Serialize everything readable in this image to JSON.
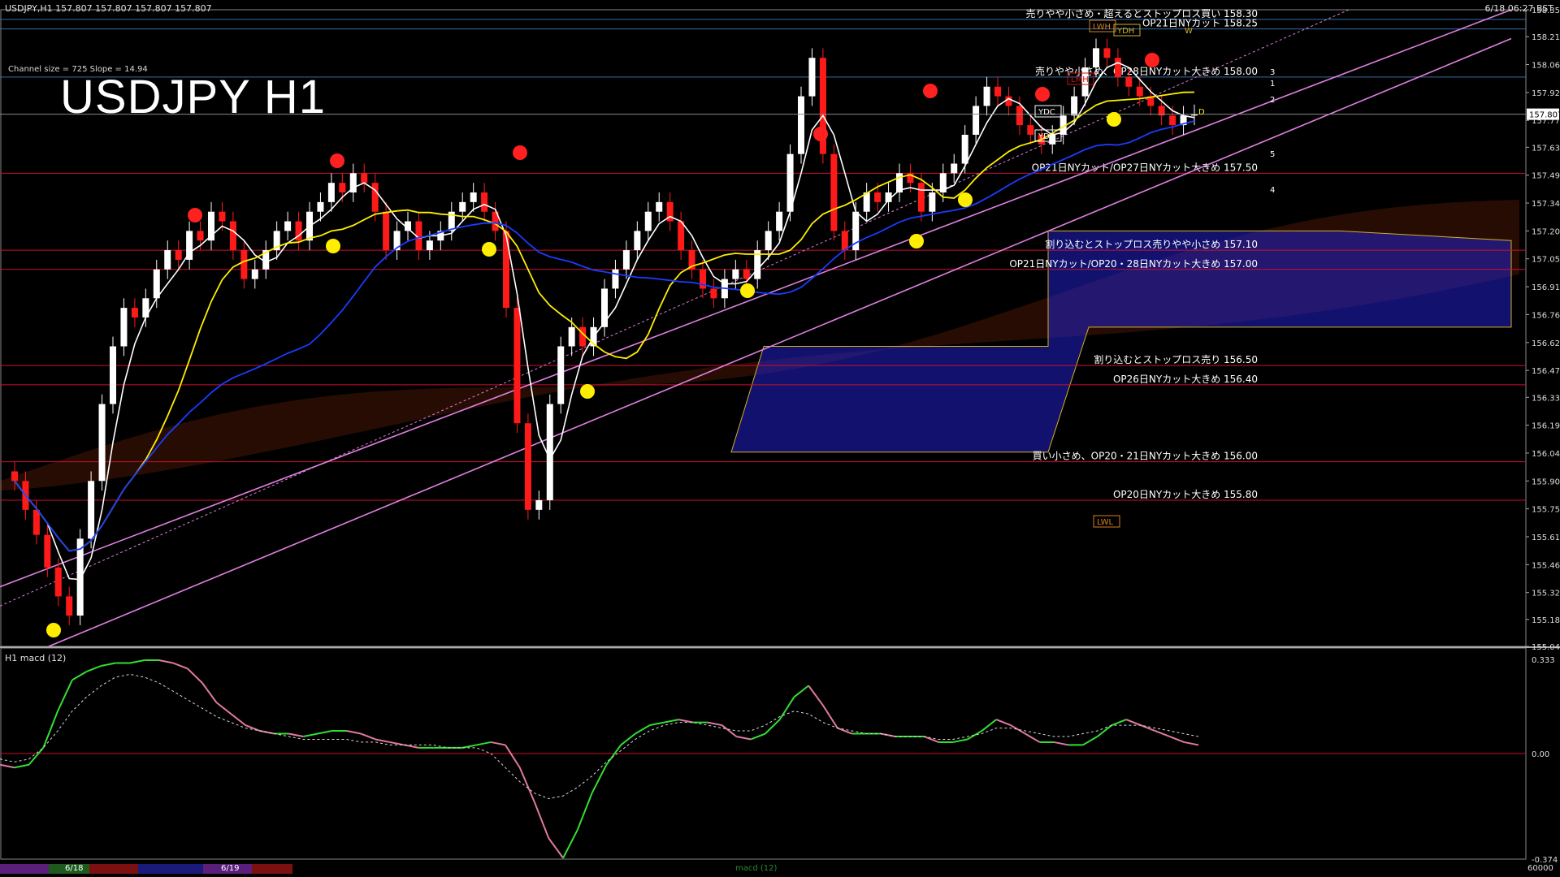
{
  "header": {
    "symbol_line": "USDJPY,H1  157.807 157.807 157.807 157.807",
    "timestamp": "6/18 06:27 BST",
    "channel_info": "Channel size = 725 Slope = 14.94",
    "title": "USDJPY H1"
  },
  "colors": {
    "background": "#000000",
    "grid_h": "#3a6ea5",
    "level_red": "#c8102e",
    "channel": "#e080e0",
    "candle_bull": "#ffffff",
    "candle_bear": "#ff1a1a",
    "ma_fast": "#ffffff",
    "ma_mid": "#ffee00",
    "ma_slow": "#1a3cff",
    "ichimoku_bull": "#2020c8",
    "ichimoku_bear": "#d04010",
    "macd": "#32e032",
    "macd_neg": "#e07aa0",
    "signal": "#d8d8d8"
  },
  "chart_data": {
    "type": "candlestick",
    "title": "USDJPY H1",
    "ylim": [
      155.04,
      158.35
    ],
    "y_ticks": [
      158.35,
      158.21,
      158.065,
      157.92,
      157.775,
      157.635,
      157.49,
      157.345,
      157.2,
      157.055,
      156.91,
      156.765,
      156.62,
      156.475,
      156.335,
      156.19,
      156.045,
      155.9,
      155.755,
      155.61,
      155.465,
      155.32,
      155.18,
      155.04
    ],
    "current_price": "157.807",
    "closes": [
      155.9,
      155.75,
      155.62,
      155.45,
      155.3,
      155.2,
      155.6,
      155.9,
      156.3,
      156.6,
      156.8,
      156.75,
      156.85,
      157.0,
      157.1,
      157.05,
      157.2,
      157.15,
      157.3,
      157.25,
      157.1,
      156.95,
      157.0,
      157.1,
      157.2,
      157.25,
      157.15,
      157.3,
      157.35,
      157.45,
      157.4,
      157.5,
      157.45,
      157.3,
      157.1,
      157.2,
      157.25,
      157.1,
      157.15,
      157.2,
      157.3,
      157.35,
      157.4,
      157.3,
      157.2,
      156.8,
      156.2,
      155.75,
      155.8,
      156.3,
      156.6,
      156.7,
      156.6,
      156.7,
      156.9,
      157.0,
      157.1,
      157.2,
      157.3,
      157.35,
      157.25,
      157.1,
      157.0,
      156.9,
      156.85,
      156.95,
      157.0,
      156.95,
      157.1,
      157.2,
      157.3,
      157.6,
      157.9,
      158.1,
      157.6,
      157.2,
      157.1,
      157.3,
      157.4,
      157.35,
      157.4,
      157.5,
      157.45,
      157.3,
      157.4,
      157.5,
      157.55,
      157.7,
      157.85,
      157.95,
      157.9,
      157.85,
      157.75,
      157.7,
      157.65,
      157.7,
      157.8,
      157.9,
      158.05,
      158.15,
      158.1,
      158.0,
      157.95,
      157.9,
      157.85,
      157.8,
      157.75,
      157.8,
      157.807
    ],
    "macd": [
      -0.04,
      -0.05,
      -0.04,
      0.02,
      0.15,
      0.26,
      0.29,
      0.31,
      0.32,
      0.32,
      0.33,
      0.33,
      0.32,
      0.3,
      0.25,
      0.18,
      0.14,
      0.1,
      0.08,
      0.07,
      0.07,
      0.06,
      0.07,
      0.08,
      0.08,
      0.07,
      0.05,
      0.04,
      0.03,
      0.02,
      0.02,
      0.02,
      0.02,
      0.03,
      0.04,
      0.03,
      -0.05,
      -0.17,
      -0.3,
      -0.37,
      -0.27,
      -0.14,
      -0.04,
      0.03,
      0.07,
      0.1,
      0.11,
      0.12,
      0.11,
      0.11,
      0.1,
      0.06,
      0.05,
      0.07,
      0.12,
      0.2,
      0.24,
      0.17,
      0.09,
      0.07,
      0.07,
      0.07,
      0.06,
      0.06,
      0.06,
      0.04,
      0.04,
      0.05,
      0.08,
      0.12,
      0.1,
      0.07,
      0.04,
      0.04,
      0.03,
      0.03,
      0.06,
      0.1,
      0.12,
      0.1,
      0.08,
      0.06,
      0.04,
      0.03
    ],
    "macd_signal": [
      -0.02,
      -0.03,
      -0.02,
      0.02,
      0.08,
      0.15,
      0.2,
      0.24,
      0.27,
      0.28,
      0.27,
      0.25,
      0.22,
      0.19,
      0.16,
      0.13,
      0.11,
      0.09,
      0.08,
      0.07,
      0.06,
      0.05,
      0.05,
      0.05,
      0.05,
      0.04,
      0.04,
      0.03,
      0.03,
      0.03,
      0.03,
      0.02,
      0.02,
      0.02,
      0.0,
      -0.05,
      -0.1,
      -0.14,
      -0.16,
      -0.15,
      -0.12,
      -0.08,
      -0.03,
      0.01,
      0.05,
      0.08,
      0.1,
      0.11,
      0.11,
      0.1,
      0.09,
      0.08,
      0.08,
      0.1,
      0.13,
      0.15,
      0.14,
      0.11,
      0.09,
      0.08,
      0.07,
      0.07,
      0.06,
      0.06,
      0.06,
      0.05,
      0.05,
      0.06,
      0.07,
      0.09,
      0.09,
      0.08,
      0.07,
      0.06,
      0.06,
      0.07,
      0.08,
      0.1,
      0.1,
      0.1,
      0.09,
      0.08,
      0.07,
      0.06
    ],
    "macd_ylim": [
      -0.374,
      0.333
    ],
    "macd_ticks": [
      "0.333",
      "0.00",
      "-0.374"
    ],
    "macd_title": "H1  macd (12)",
    "levels": [
      {
        "price": 158.3,
        "label": "売りやや小さめ・超えるとストップロス買い 158.30",
        "color": "#3a6ea5"
      },
      {
        "price": 158.25,
        "label": "OP21日NYカット 158.25",
        "color": "#3a6ea5"
      },
      {
        "price": 158.0,
        "label": "売りやや小さめ、OP28日NYカット大きめ 158.00",
        "color": "#3a6ea5"
      },
      {
        "price": 157.5,
        "label": "OP21日NYカット/OP27日NYカット大きめ 157.50",
        "color": "#c8102e"
      },
      {
        "price": 157.1,
        "label": "割り込むとストップロス売りやや小さめ 157.10",
        "color": "#c8102e"
      },
      {
        "price": 157.0,
        "label": "OP21日NYカット/OP20・28日NYカット大きめ 157.00",
        "color": "#c8102e"
      },
      {
        "price": 156.5,
        "label": "割り込むとストップロス売り 156.50",
        "color": "#c8102e"
      },
      {
        "price": 156.4,
        "label": "OP26日NYカット大きめ 156.40",
        "color": "#c8102e"
      },
      {
        "price": 156.0,
        "label": "買い小さめ、OP20・21日NYカット大きめ 156.00",
        "color": "#c8102e"
      },
      {
        "price": 155.8,
        "label": "OP20日NYカット大きめ 155.80",
        "color": "#c8102e"
      }
    ],
    "markers": [
      "LWH",
      "YDH",
      "W",
      "LMH",
      "YDC",
      "YDO",
      "D",
      "LWL",
      "1",
      "2",
      "3",
      "4",
      "5"
    ],
    "date_labels": [
      "6/18",
      "6/19"
    ],
    "bottom_tags": [
      "macd (12)"
    ],
    "bottom_right": "60000"
  }
}
